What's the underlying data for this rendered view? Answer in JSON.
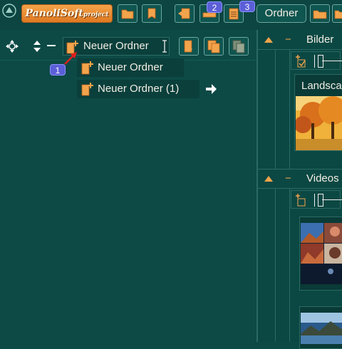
{
  "toolbar": {
    "logo_text": "PanoliSoft",
    "logo_sub": "project",
    "ordner_label": "Ordner",
    "badges": [
      "2",
      "3"
    ],
    "icons": [
      "up-circle-icon",
      "open-folder-icon",
      "tag-icon",
      "import-icon",
      "stack-icon",
      "clipboard-list-icon",
      "folder-open-icon",
      "folder-arrow-icon"
    ]
  },
  "tree": {
    "edit_value": "Neuer Ordner",
    "badge": "1",
    "items": [
      {
        "label": "Neuer Ordner"
      },
      {
        "label": "Neuer Ordner (1)"
      }
    ]
  },
  "right": {
    "sections": [
      {
        "title": "Bilder",
        "card_label": "Landsca"
      },
      {
        "title": "Videos"
      }
    ],
    "collapse_symbol": "−"
  },
  "colors": {
    "background": "#0d4a46",
    "accent_orange": "#f2a44c",
    "badge": "#5b5fd8"
  }
}
